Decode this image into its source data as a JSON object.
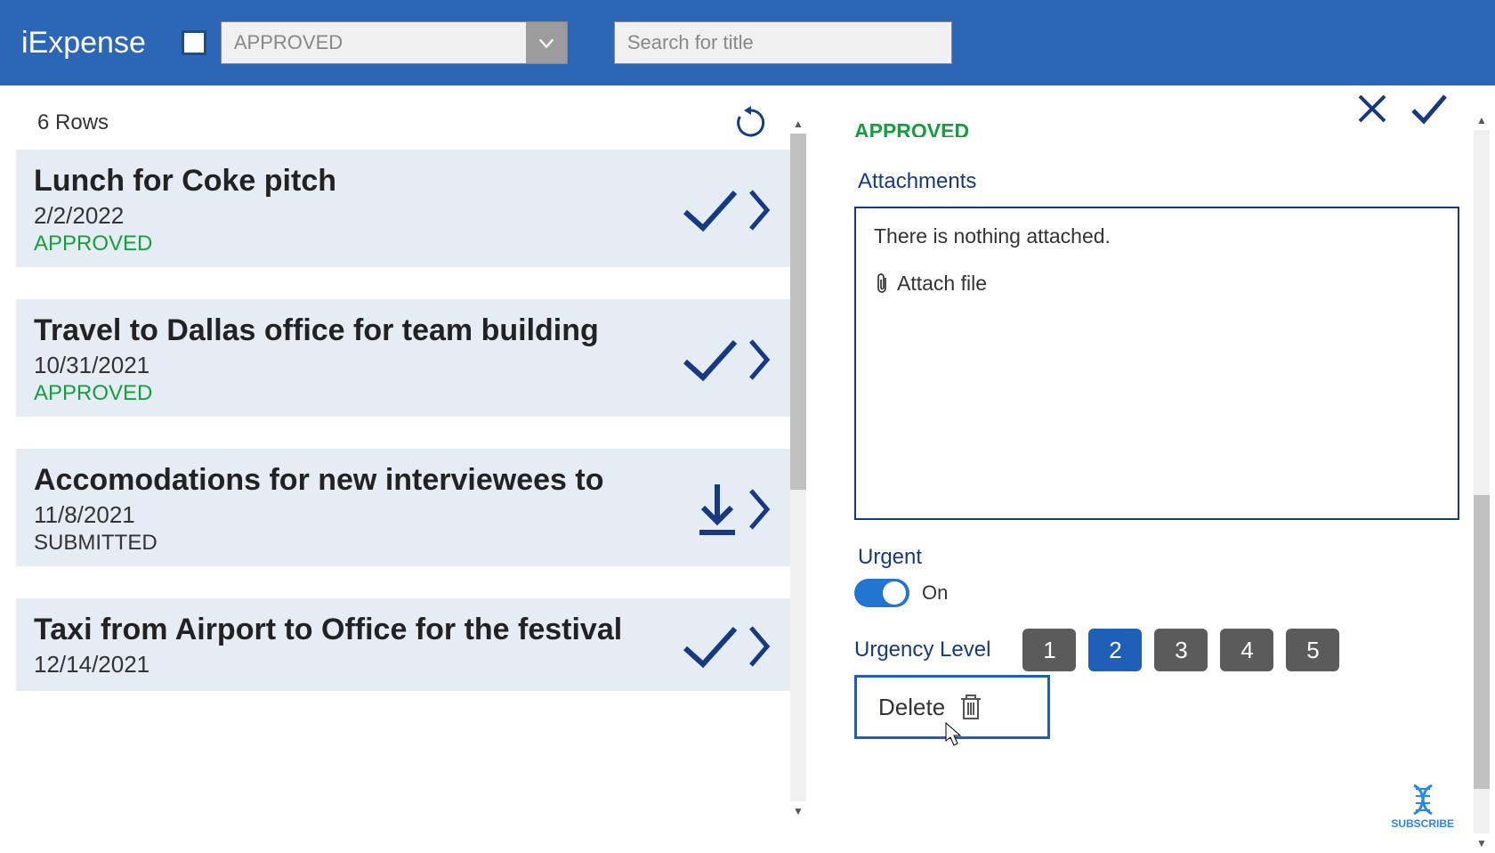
{
  "app": {
    "title": "iExpense"
  },
  "header": {
    "filter_placeholder": "APPROVED",
    "search_placeholder": "Search for title"
  },
  "list": {
    "row_count_label": "6 Rows",
    "items": [
      {
        "title": "Lunch for Coke pitch",
        "date": "2/2/2022",
        "status": "APPROVED",
        "icon": "check"
      },
      {
        "title": "Travel to Dallas office for team building",
        "date": "10/31/2021",
        "status": "APPROVED",
        "icon": "check"
      },
      {
        "title": "Accomodations for new interviewees to",
        "date": "11/8/2021",
        "status": "SUBMITTED",
        "icon": "download"
      },
      {
        "title": "Taxi from Airport to Office for the festival",
        "date": "12/14/2021",
        "status": "",
        "icon": "check"
      }
    ]
  },
  "detail": {
    "status_text": "APPROVED",
    "attachments_label": "Attachments",
    "attachments_empty": "There is nothing attached.",
    "attach_action": "Attach file",
    "urgent_label": "Urgent",
    "urgent_value_text": "On",
    "urgency_label": "Urgency Level",
    "urgency_levels": [
      "1",
      "2",
      "3",
      "4",
      "5"
    ],
    "urgency_selected": "2",
    "delete_label": "Delete"
  },
  "subscribe_text": "SUBSCRIBE"
}
